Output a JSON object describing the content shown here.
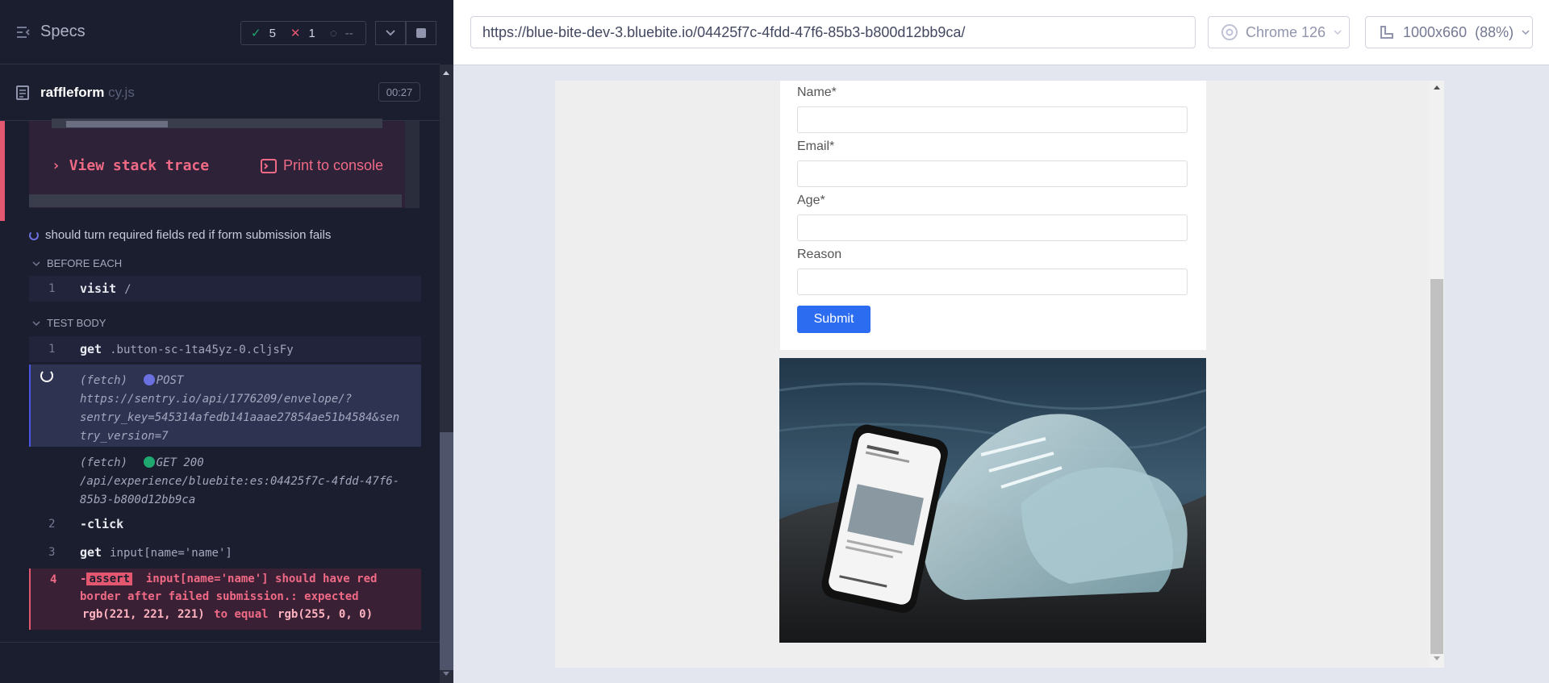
{
  "reporter": {
    "specs_label": "Specs",
    "stats": {
      "passed": "5",
      "failed": "1",
      "pending": "--"
    },
    "spec": {
      "name": "raffleform",
      "ext": " cy.js",
      "duration": "00:27"
    },
    "error": {
      "stack_trace": "View stack trace",
      "print": "Print to console"
    },
    "test": {
      "title": "should turn required fields red if form submission fails",
      "before_each_label": "BEFORE EACH",
      "before_each": [
        {
          "num": "1",
          "name": "visit",
          "arg": "/"
        }
      ],
      "body_label": "TEST BODY",
      "body": [
        {
          "num": "1",
          "name": "get",
          "arg": ".button-sc-1ta45yz-0.cljsFy"
        },
        {
          "fetch": "(fetch)",
          "method": "POST",
          "url_lines": [
            "https://sentry.io/api/1776209/envelope/?",
            "sentry_key=545314afedb141aaae27854ae51b4584&sen",
            "try_version=7"
          ]
        },
        {
          "fetch": "(fetch)",
          "method": "GET 200",
          "url_lines": [
            "/api/experience/bluebite:es:04425f7c-4fdd-47f6-",
            "85b3-b800d12bb9ca"
          ]
        },
        {
          "num": "2",
          "name": "-click"
        },
        {
          "num": "3",
          "name": "get",
          "arg": "input[name='name']"
        },
        {
          "num": "4",
          "name": "-",
          "badge": "assert",
          "line1": "input[name='name'] should have red",
          "line2": "border after failed submission.: expected",
          "val1": "rgb(221, 221, 221)",
          "mid": "to equal",
          "val2": "rgb(255, 0, 0)"
        }
      ]
    }
  },
  "aut": {
    "url": "https://blue-bite-dev-3.bluebite.io/04425f7c-4fdd-47f6-85b3-b800d12bb9ca/",
    "browser": "Chrome 126",
    "viewport": "1000x660",
    "zoom": "(88%)",
    "form": {
      "fields": [
        "Name*",
        "Email*",
        "Age*",
        "Reason"
      ],
      "submit": "Submit"
    }
  },
  "colors": {
    "pass": "#1fa971",
    "fail": "#e45770",
    "accent": "#2b6cf0"
  }
}
